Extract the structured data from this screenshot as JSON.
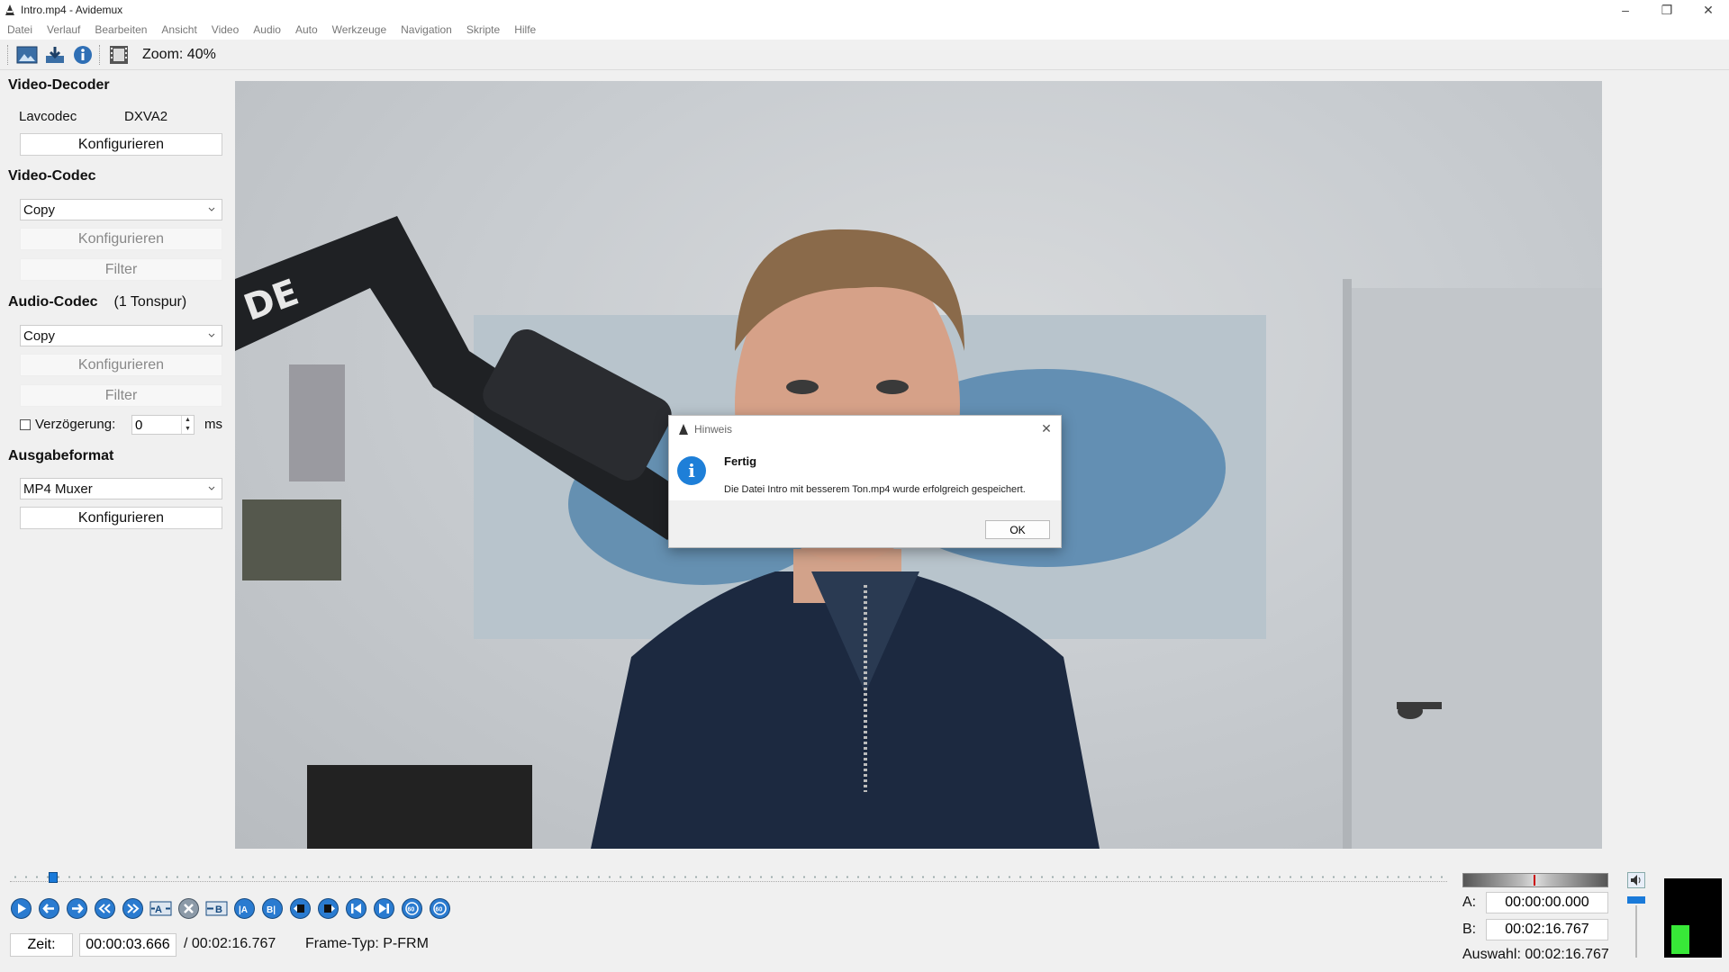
{
  "window": {
    "title": "Intro.mp4 - Avidemux",
    "minimize_icon": "minimize-icon",
    "maximize_icon": "restore-icon",
    "close_icon": "close-icon"
  },
  "menu": [
    "Datei",
    "Verlauf",
    "Bearbeiten",
    "Ansicht",
    "Video",
    "Audio",
    "Auto",
    "Werkzeuge",
    "Navigation",
    "Skripte",
    "Hilfe"
  ],
  "toolbar": {
    "zoom": "Zoom: 40%"
  },
  "left": {
    "video_decoder": {
      "title": "Video-Decoder",
      "decoder_name": "Lavcodec",
      "decoder_value": "DXVA2",
      "configure": "Konfigurieren"
    },
    "video_codec": {
      "title": "Video-Codec",
      "selected": "Copy",
      "configure": "Konfigurieren",
      "filter": "Filter"
    },
    "audio_codec": {
      "title": "Audio-Codec",
      "tracks": "(1 Tonspur)",
      "selected": "Copy",
      "configure": "Konfigurieren",
      "filter": "Filter",
      "delay_label": "Verzögerung:",
      "delay_value": "0",
      "delay_unit": "ms"
    },
    "output_format": {
      "title": "Ausgabeformat",
      "selected": "MP4 Muxer",
      "configure": "Konfigurieren"
    }
  },
  "dialog": {
    "title": "Hinweis",
    "heading": "Fertig",
    "message": "Die Datei Intro mit besserem Ton.mp4 wurde erfolgreich gespeichert.",
    "ok": "OK"
  },
  "playback": {
    "position_fraction": 0.027
  },
  "status": {
    "time_label": "Zeit:",
    "current_time": "00:00:03.666",
    "duration": "/ 00:02:16.767",
    "frame_type": "Frame-Typ: P-FRM"
  },
  "markers": {
    "a_label": "A:",
    "a_value": "00:00:00.000",
    "b_label": "B:",
    "b_value": "00:02:16.767",
    "selection": "Auswahl: 00:02:16.767"
  },
  "colors": {
    "accent": "#1a7ad9",
    "info": "#1e7fd8",
    "meter": "#38e838"
  }
}
